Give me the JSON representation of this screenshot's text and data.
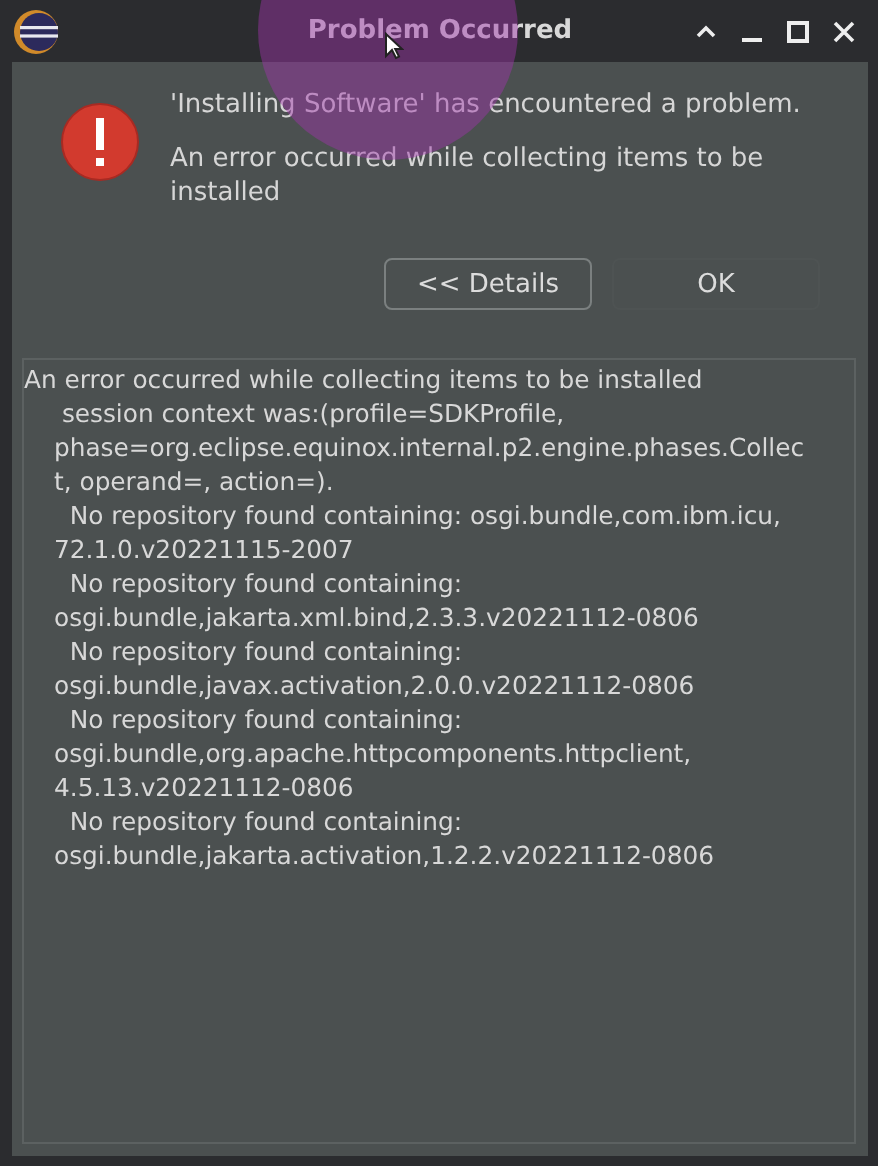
{
  "window": {
    "title": "Problem Occurred"
  },
  "message": {
    "title": "'Installing Software' has encountered a problem.",
    "text": "An error occurred while collecting items to be installed"
  },
  "buttons": [
    {
      "label": "<< Details",
      "kind": "outlined"
    },
    {
      "label": "OK",
      "kind": "flat"
    }
  ],
  "details": {
    "heading": "An error occurred while collecting items to be installed",
    "lines": [
      " session context was:(profile=SDKProfile,",
      "phase=org.eclipse.equinox.internal.p2.engine.phases.Collec",
      "t, operand=, action=).",
      "  No repository found containing: osgi.bundle,com.ibm.icu,",
      "72.1.0.v20221115-2007",
      "  No repository found containing:",
      "osgi.bundle,jakarta.xml.bind,2.3.3.v20221112-0806",
      "  No repository found containing:",
      "osgi.bundle,javax.activation,2.0.0.v20221112-0806",
      "  No repository found containing:",
      "osgi.bundle,org.apache.httpcomponents.httpclient,",
      "4.5.13.v20221112-0806",
      "  No repository found containing:",
      "osgi.bundle,jakarta.activation,1.2.2.v20221112-0806"
    ]
  }
}
